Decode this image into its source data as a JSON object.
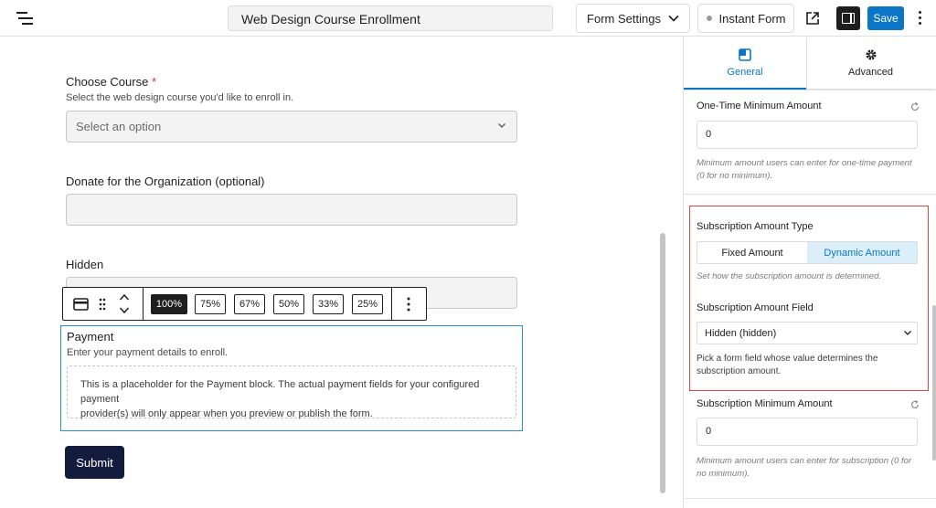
{
  "header": {
    "form_title": "Web Design Course Enrollment",
    "form_settings_label": "Form Settings",
    "instant_form_label": "Instant Form",
    "save_label": "Save"
  },
  "form": {
    "choose_course": {
      "label": "Choose Course",
      "required_mark": "*",
      "help": "Select the web design course you'd like to enroll in.",
      "placeholder": "Select an option"
    },
    "donate": {
      "label": "Donate for the Organization (optional)"
    },
    "hidden": {
      "label": "Hidden"
    },
    "toolbar": {
      "widths": [
        "100%",
        "75%",
        "67%",
        "50%",
        "33%",
        "25%"
      ],
      "active": "100%"
    },
    "payment": {
      "label": "Payment",
      "help": "Enter your payment details to enroll.",
      "placeholder_line1": "This is a placeholder for the Payment block. The actual payment fields for your configured payment",
      "placeholder_line2": "provider(s) will only appear when you preview or publish the form."
    },
    "submit_label": "Submit"
  },
  "sidebar": {
    "tabs": {
      "general": "General",
      "advanced": "Advanced"
    },
    "one_time_min": {
      "label": "One-Time Minimum Amount",
      "value": "0",
      "help": "Minimum amount users can enter for one-time payment (0 for no minimum)."
    },
    "subscription_type": {
      "label": "Subscription Amount Type",
      "options": [
        "Fixed Amount",
        "Dynamic Amount"
      ],
      "selected": "Dynamic Amount",
      "help": "Set how the subscription amount is determined."
    },
    "subscription_field": {
      "label": "Subscription Amount Field",
      "value": "Hidden (hidden)",
      "help": "Pick a form field whose value determines the subscription amount."
    },
    "subscription_min": {
      "label": "Subscription Minimum Amount",
      "value": "0",
      "help": "Minimum amount users can enter for subscription (0 for no minimum)."
    }
  },
  "colors": {
    "accent": "#0b76c5",
    "highlight": "#e0483e",
    "submit": "#141c3e",
    "block_outline": "#2e8bd0"
  }
}
